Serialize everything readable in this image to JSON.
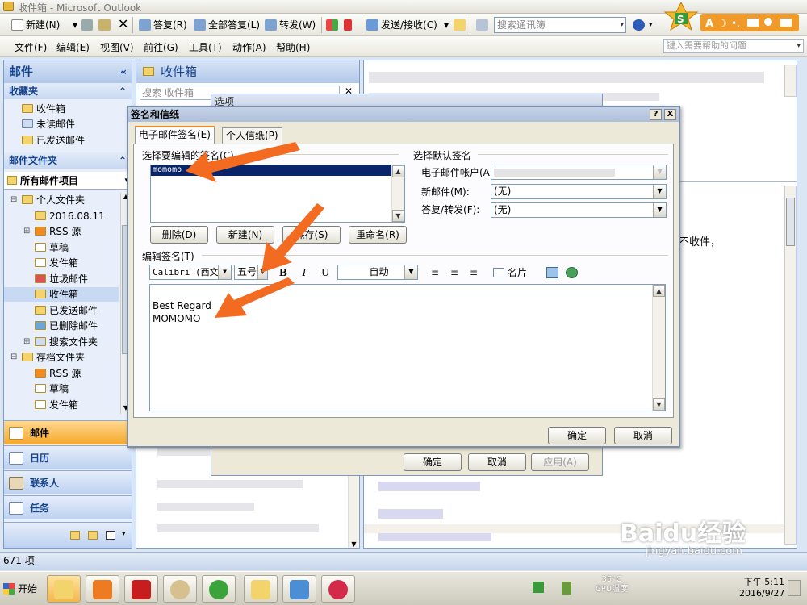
{
  "window": {
    "title": "收件箱 - Microsoft Outlook"
  },
  "toolbar": {
    "new_label": "新建(N)",
    "reply_label": "答复(R)",
    "reply_all_label": "全部答复(L)",
    "forward_label": "转发(W)",
    "send_receive_label": "发送/接收(C)",
    "address_search_placeholder": "搜索通讯簿"
  },
  "menu": {
    "items": [
      "文件(F)",
      "编辑(E)",
      "视图(V)",
      "前往(G)",
      "工具(T)",
      "动作(A)",
      "帮助(H)"
    ],
    "help_placeholder": "键入需要帮助的问题"
  },
  "nav": {
    "header": "邮件",
    "favorites_header": "收藏夹",
    "favorites": [
      "收件箱",
      "未读邮件",
      "已发送邮件"
    ],
    "mail_folders_header": "邮件文件夹",
    "all_items_label": "所有邮件项目",
    "tree": [
      {
        "label": "个人文件夹",
        "level": 0,
        "expanded": true
      },
      {
        "label": "2016.08.11",
        "level": 1
      },
      {
        "label": "RSS 源",
        "level": 1,
        "expandable": true
      },
      {
        "label": "草稿",
        "level": 1
      },
      {
        "label": "发件箱",
        "level": 1
      },
      {
        "label": "垃圾邮件",
        "level": 1
      },
      {
        "label": "收件箱",
        "level": 1,
        "selected": true
      },
      {
        "label": "已发送邮件",
        "level": 1
      },
      {
        "label": "已删除邮件",
        "level": 1
      },
      {
        "label": "搜索文件夹",
        "level": 1,
        "expandable": true
      },
      {
        "label": "存档文件夹",
        "level": 0,
        "expanded": true
      },
      {
        "label": "RSS 源",
        "level": 1
      },
      {
        "label": "草稿",
        "level": 1
      },
      {
        "label": "发件箱",
        "level": 1
      }
    ],
    "buttons": {
      "mail": "邮件",
      "calendar": "日历",
      "contacts": "联系人",
      "tasks": "任务"
    }
  },
  "list": {
    "header": "收件箱",
    "search_placeholder": "搜索 收件箱"
  },
  "reading": {
    "partial_text": "不收件，"
  },
  "status": {
    "item_count": "671 项"
  },
  "options_dialog": {
    "title": "选项",
    "ok": "确定",
    "cancel": "取消",
    "apply": "应用(A)"
  },
  "signature_dialog": {
    "title": "签名和信纸",
    "help_btn": "?",
    "close_btn": "X",
    "tabs": [
      "电子邮件签名(E)",
      "个人信纸(P)"
    ],
    "select_label": "选择要编辑的签名(C)",
    "signatures": [
      "momomo"
    ],
    "buttons": {
      "delete": "删除(D)",
      "new": "新建(N)",
      "save": "保存(S)",
      "rename": "重命名(R)"
    },
    "default_group": "选择默认签名",
    "account_label": "电子邮件帐户(A):",
    "new_msg_label": "新邮件(M):",
    "new_msg_value": "(无)",
    "reply_label": "答复/转发(F):",
    "reply_value": "(无)",
    "edit_label": "编辑签名(T)",
    "font_value": "Calibri (西文正",
    "size_value": "五号",
    "color_value": "自动",
    "bold": "B",
    "italic": "I",
    "underline": "U",
    "business_card": "名片",
    "signature_text": [
      "Best Regard",
      "MOMOMO"
    ],
    "ok": "确定",
    "cancel": "取消"
  },
  "taskbar": {
    "start_label": "开始",
    "cpu_temp": "35°C",
    "cpu_label": "CPU温度",
    "time": "下午 5:11",
    "date": "2016/9/27"
  },
  "watermark": {
    "brand": "Baidu经验",
    "url": "jingyan.baidu.com"
  },
  "colors": {
    "accent_arrow": "#f26b21",
    "nav_text": "#15428b",
    "selection": "#0a246a"
  }
}
